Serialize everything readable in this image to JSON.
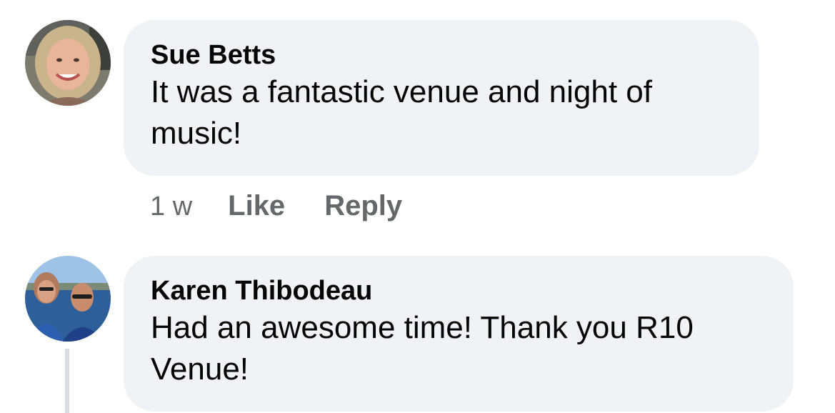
{
  "comments": [
    {
      "author": "Sue Betts",
      "text": "It was a fantastic venue and night of music!",
      "time": "1 w",
      "like_label": "Like",
      "reply_label": "Reply"
    },
    {
      "author": "Karen Thibodeau",
      "text": "Had an awesome time! Thank you R10 Venue!"
    }
  ],
  "colors": {
    "bubble_bg": "#f0f2f5",
    "secondary_text": "#65676b",
    "primary_text": "#050505",
    "thread_line": "#dadde1"
  }
}
